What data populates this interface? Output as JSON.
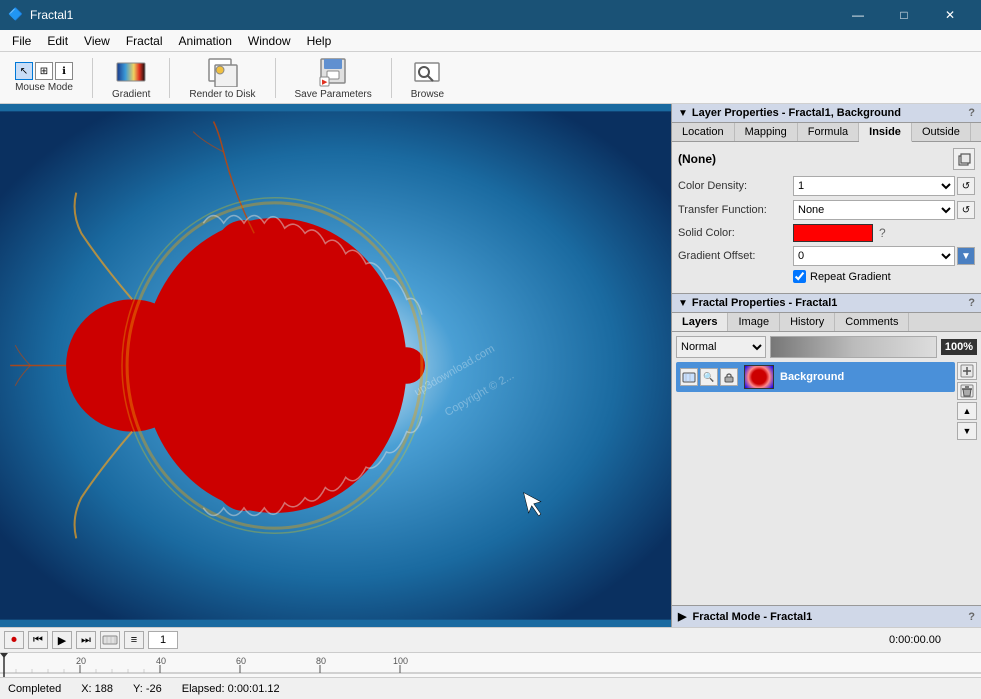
{
  "app": {
    "title": "Fractal1",
    "full_title": "Fractal1"
  },
  "titlebar": {
    "icon": "🔷",
    "title": "Fractal1",
    "minimize": "—",
    "maximize": "□",
    "close": "✕"
  },
  "menubar": {
    "items": [
      "File",
      "Edit",
      "View",
      "Fractal",
      "Animation",
      "Window",
      "Help"
    ]
  },
  "toolbar": {
    "mouse_mode_label": "Mouse Mode",
    "gradient_label": "Gradient",
    "render_label": "Render to Disk",
    "save_label": "Save Parameters",
    "browse_label": "Browse"
  },
  "layer_properties": {
    "title": "Layer Properties - Fractal1, Background",
    "help": "?",
    "tabs": [
      "Location",
      "Mapping",
      "Formula",
      "Inside",
      "Outside"
    ],
    "active_tab": "Inside",
    "none_label": "(None)",
    "color_density_label": "Color Density:",
    "color_density_value": "1",
    "transfer_fn_label": "Transfer Function:",
    "transfer_fn_value": "None",
    "solid_color_label": "Solid Color:",
    "gradient_offset_label": "Gradient Offset:",
    "gradient_offset_value": "0",
    "repeat_gradient_label": "Repeat Gradient",
    "repeat_gradient_checked": true
  },
  "fractal_properties": {
    "title": "Fractal Properties - Fractal1",
    "help": "?",
    "tabs": [
      "Layers",
      "Image",
      "History",
      "Comments"
    ],
    "active_tab": "Layers",
    "blend_mode": "Normal",
    "opacity_value": "100%",
    "layer_name": "Background"
  },
  "fractal_mode": {
    "title": "Fractal Mode - Fractal1",
    "help": "?"
  },
  "animation": {
    "record_symbol": "⏺",
    "prev_keyframe": "⏮",
    "play": "▶",
    "next_keyframe": "⏭",
    "add_keyframe": "🔑",
    "timeline_symbol": "≡",
    "frame_value": "1",
    "time_display": "0:00:00.00"
  },
  "timeline": {
    "markers": [
      "20",
      "40",
      "60",
      "80",
      "100"
    ]
  },
  "statusbar": {
    "status": "Completed",
    "x_label": "X:",
    "x_value": "188",
    "y_label": "Y:",
    "y_value": "-26",
    "elapsed_label": "Elapsed:",
    "elapsed_value": "0:00:01.12"
  }
}
